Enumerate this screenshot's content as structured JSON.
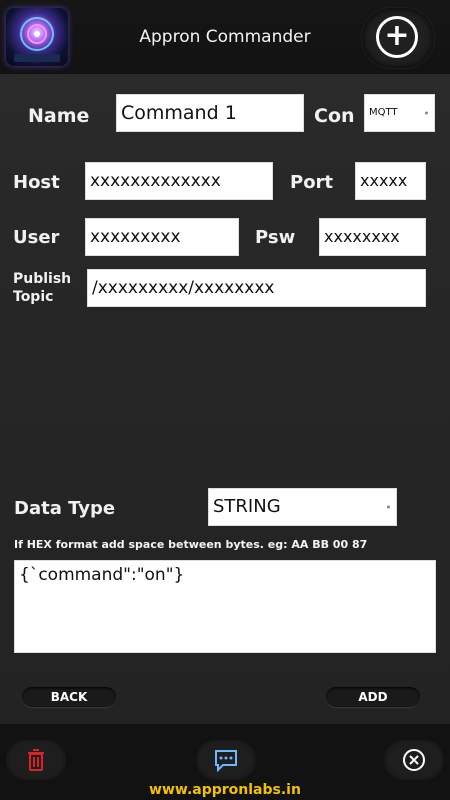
{
  "header": {
    "title": "Appron Commander",
    "add_icon": "plus-circle-icon"
  },
  "form": {
    "name_label": "Name",
    "name_value": "Command 1",
    "con_label": "Con",
    "con_value": "MQTT",
    "host_label": "Host",
    "host_value": "xxxxxxxxxxxxx",
    "port_label": "Port",
    "port_value": "xxxxx",
    "user_label": "User",
    "user_value": "xxxxxxxxx",
    "psw_label": "Psw",
    "psw_value": "xxxxxxxx",
    "topic_label_1": "Publish",
    "topic_label_2": "Topic",
    "topic_value": "/xxxxxxxxx/xxxxxxxx",
    "datatype_label": "Data Type",
    "datatype_value": "STRING",
    "hint": "If HEX format add space between bytes. eg: AA BB 00 87",
    "data_value": "{`command\":\"on\"}"
  },
  "actions": {
    "back_label": "BACK",
    "add_label": "ADD"
  },
  "footer": {
    "delete_icon": "trash-icon",
    "message_icon": "chat-bubble-icon",
    "close_icon": "close-circle-icon",
    "website": "www.appronlabs.in"
  },
  "colors": {
    "accent": "#f2c200",
    "delete": "#d9232b",
    "message": "#6fb6ff"
  }
}
